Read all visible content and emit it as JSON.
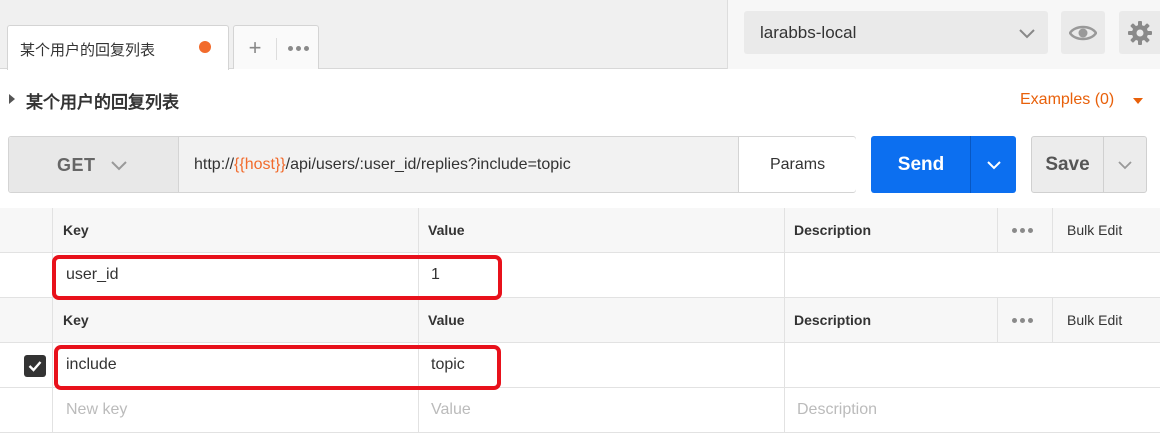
{
  "tabs": {
    "active_tab_label": "某个用户的回复列表",
    "add_label": "+"
  },
  "environment": {
    "selected": "larabbs-local"
  },
  "request": {
    "name": "某个用户的回复列表",
    "examples_label": "Examples (0)",
    "method": "GET",
    "url_prefix": "http://",
    "url_variable": "{{host}}",
    "url_suffix": "/api/users/:user_id/replies?include=topic",
    "params_label": "Params",
    "send_label": "Send",
    "save_label": "Save"
  },
  "path_variables": {
    "headers": {
      "key": "Key",
      "value": "Value",
      "description": "Description",
      "bulk_edit": "Bulk Edit"
    },
    "rows": [
      {
        "key": "user_id",
        "value": "1",
        "description": ""
      }
    ]
  },
  "query_params": {
    "headers": {
      "key": "Key",
      "value": "Value",
      "description": "Description",
      "bulk_edit": "Bulk Edit"
    },
    "rows": [
      {
        "checked": true,
        "key": "include",
        "value": "topic",
        "description": ""
      }
    ],
    "new_row": {
      "key_placeholder": "New key",
      "value_placeholder": "Value",
      "description_placeholder": "Description"
    }
  },
  "colors": {
    "accent_orange": "#e8600a",
    "send_blue": "#0c6ff0",
    "highlight_red": "#e8111b"
  }
}
